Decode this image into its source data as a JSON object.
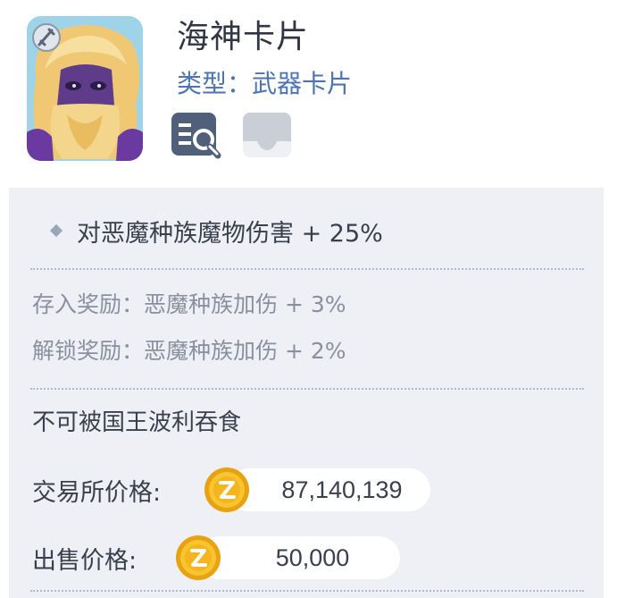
{
  "card": {
    "name": "海神卡片",
    "type_text": "类型：武器卡片"
  },
  "icons": {
    "portrait_badge": "sword-icon",
    "detail": "search-list-icon",
    "store": "tray-icon",
    "coin": "zeny-coin-icon"
  },
  "effect": {
    "text": "对恶魔种族魔物伤害 + 25%"
  },
  "bonuses": {
    "deposit_label": "存入奖励：",
    "deposit_value": "恶魔种族加伤 + 3%",
    "unlock_label": "解锁奖励：",
    "unlock_value": "恶魔种族加伤 + 2%"
  },
  "note": "不可被国王波利吞食",
  "prices": {
    "exchange_label": "交易所价格:",
    "exchange_value": "87,140,139",
    "sell_label": "出售价格:",
    "sell_value": "50,000"
  },
  "colors": {
    "type_text": "#4d74b2",
    "panel_bg": "#eef0f5",
    "coin": "#f2b21a"
  }
}
